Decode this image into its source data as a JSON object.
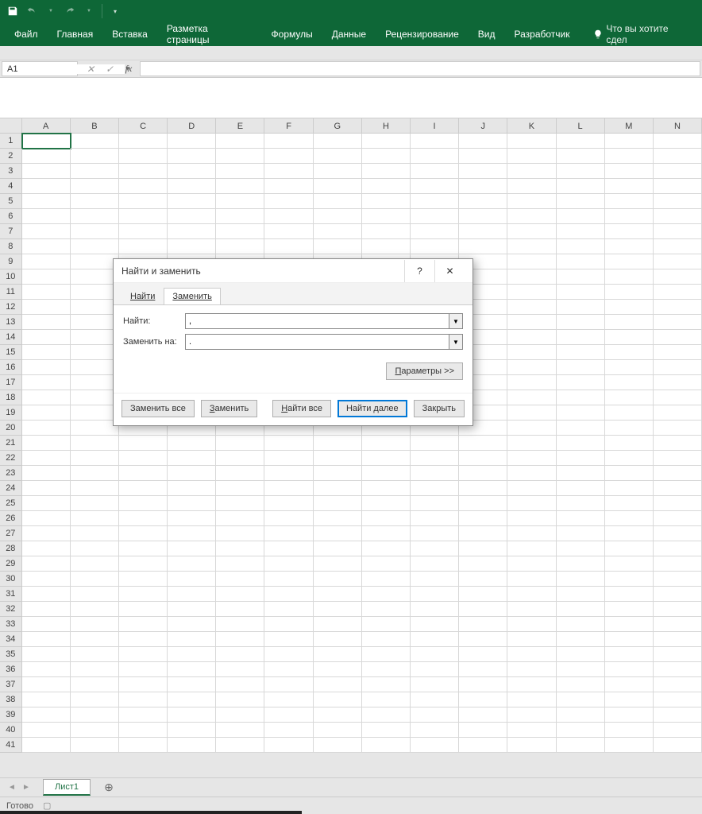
{
  "qat": {
    "save": "save",
    "undo": "undo",
    "redo": "redo"
  },
  "ribbon": {
    "tabs": [
      "Файл",
      "Главная",
      "Вставка",
      "Разметка страницы",
      "Формулы",
      "Данные",
      "Рецензирование",
      "Вид",
      "Разработчик"
    ],
    "tellme": "Что вы хотите сдел"
  },
  "namebox": {
    "value": "A1"
  },
  "columns": [
    "A",
    "B",
    "C",
    "D",
    "E",
    "F",
    "G",
    "H",
    "I",
    "J",
    "K",
    "L",
    "M",
    "N"
  ],
  "row_count": 41,
  "selected_cell": "A1",
  "dialog": {
    "title": "Найти и заменить",
    "help": "?",
    "tabs": {
      "find": "Найти",
      "replace": "Заменить"
    },
    "active_tab": "replace",
    "labels": {
      "find": "Найти:",
      "replace": "Заменить на:"
    },
    "values": {
      "find": ",",
      "replace": "."
    },
    "params_btn": "Параметры >>",
    "buttons": {
      "replace_all": "Заменить все",
      "replace": "Заменить",
      "find_all": "Найти все",
      "find_next": "Найти далее",
      "close": "Закрыть"
    }
  },
  "sheet": {
    "name": "Лист1"
  },
  "status": {
    "ready": "Готово"
  }
}
